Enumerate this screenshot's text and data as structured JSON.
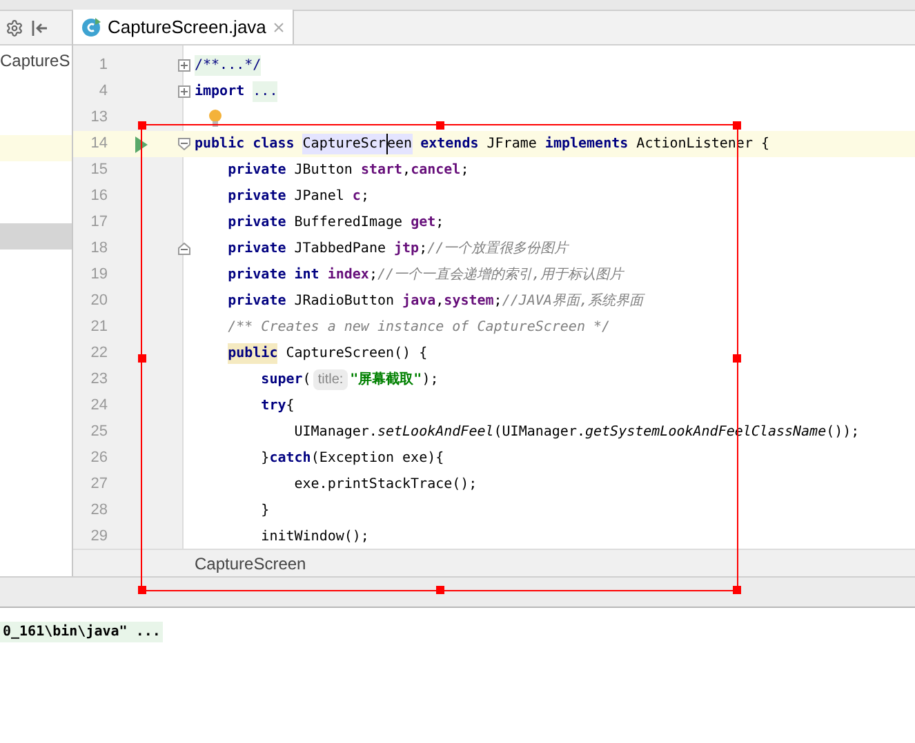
{
  "project_panel": {
    "item": "CaptureS"
  },
  "tab": {
    "label": "CaptureScreen.java",
    "selected": true
  },
  "lines": [
    {
      "number": "1",
      "fold_marker": {
        "kind": "expand"
      },
      "tokens": [
        {
          "text": "/**...*/",
          "kind": "folded"
        }
      ]
    },
    {
      "number": "4",
      "fold_marker": {
        "kind": "expand"
      },
      "tokens": [
        {
          "text": "import ",
          "kind": "keyword"
        },
        {
          "text": "...",
          "kind": "folded"
        }
      ]
    },
    {
      "number": "13",
      "gutter_icon": {
        "kind": "bulb"
      }
    },
    {
      "number": "14",
      "gutter_icon": {
        "kind": "run"
      },
      "fold_marker": {
        "kind": "collapse"
      },
      "current": true,
      "tokens": [
        {
          "text": "public class ",
          "kind": "keyword"
        },
        {
          "text": "CaptureScr",
          "kind": "usage",
          "caret": true
        },
        {
          "text": "een",
          "kind": "usage"
        },
        {
          "text": " extends ",
          "kind": "keyword"
        },
        {
          "text": "JFrame ",
          "kind": "plain"
        },
        {
          "text": "implements",
          "kind": "keyword"
        },
        {
          "text": " ActionListener {",
          "kind": "plain"
        }
      ]
    },
    {
      "number": "15",
      "tokens": [
        {
          "text": "    private ",
          "kind": "keyword"
        },
        {
          "text": "JButton ",
          "kind": "plain"
        },
        {
          "text": "start",
          "kind": "field"
        },
        {
          "text": ",",
          "kind": "plain"
        },
        {
          "text": "cancel",
          "kind": "field"
        },
        {
          "text": ";",
          "kind": "plain"
        }
      ]
    },
    {
      "number": "16",
      "tokens": [
        {
          "text": "    private ",
          "kind": "keyword"
        },
        {
          "text": "JPanel ",
          "kind": "plain"
        },
        {
          "text": "c",
          "kind": "field"
        },
        {
          "text": ";",
          "kind": "plain"
        }
      ]
    },
    {
      "number": "17",
      "tokens": [
        {
          "text": "    private ",
          "kind": "keyword"
        },
        {
          "text": "BufferedImage ",
          "kind": "plain"
        },
        {
          "text": "get",
          "kind": "field"
        },
        {
          "text": ";",
          "kind": "plain"
        }
      ]
    },
    {
      "number": "18",
      "fold_marker": {
        "kind": "end"
      },
      "tokens": [
        {
          "text": "    private ",
          "kind": "keyword"
        },
        {
          "text": "JTabbedPane ",
          "kind": "plain"
        },
        {
          "text": "jtp",
          "kind": "field"
        },
        {
          "text": ";",
          "kind": "plain"
        },
        {
          "text": "//一个放置很多份图片",
          "kind": "comment"
        }
      ]
    },
    {
      "number": "19",
      "tokens": [
        {
          "text": "    private int ",
          "kind": "keyword"
        },
        {
          "text": "index",
          "kind": "field"
        },
        {
          "text": ";",
          "kind": "plain"
        },
        {
          "text": "//一个一直会递增的索引,用于标认图片",
          "kind": "comment"
        }
      ]
    },
    {
      "number": "20",
      "tokens": [
        {
          "text": "    private ",
          "kind": "keyword"
        },
        {
          "text": "JRadioButton ",
          "kind": "plain"
        },
        {
          "text": "java",
          "kind": "field"
        },
        {
          "text": ",",
          "kind": "plain"
        },
        {
          "text": "system",
          "kind": "field"
        },
        {
          "text": ";",
          "kind": "plain"
        },
        {
          "text": "//JAVA界面,系统界面",
          "kind": "comment"
        }
      ]
    },
    {
      "number": "21",
      "tokens": [
        {
          "text": "    /** Creates a new instance of CaptureScreen */",
          "kind": "comment"
        }
      ]
    },
    {
      "number": "22",
      "tokens": [
        {
          "text": "    public",
          "kind": "keyword_match"
        },
        {
          "text": " CaptureScreen() {",
          "kind": "plain"
        }
      ]
    },
    {
      "number": "23",
      "tokens": [
        {
          "text": "        super",
          "kind": "keyword"
        },
        {
          "text": "(",
          "kind": "plain"
        },
        {
          "text": "title:",
          "kind": "hint"
        },
        {
          "text": "\"屏幕截取\"",
          "kind": "string"
        },
        {
          "text": ");",
          "kind": "plain"
        }
      ]
    },
    {
      "number": "24",
      "tokens": [
        {
          "text": "        try",
          "kind": "keyword"
        },
        {
          "text": "{",
          "kind": "plain"
        }
      ]
    },
    {
      "number": "25",
      "tokens": [
        {
          "text": "            UIManager.",
          "kind": "plain"
        },
        {
          "text": "setLookAndFeel",
          "kind": "static"
        },
        {
          "text": "(UIManager.",
          "kind": "plain"
        },
        {
          "text": "getSystemLookAndFeelClassName",
          "kind": "static"
        },
        {
          "text": "());",
          "kind": "plain"
        }
      ]
    },
    {
      "number": "26",
      "tokens": [
        {
          "text": "        }",
          "kind": "plain"
        },
        {
          "text": "catch",
          "kind": "keyword"
        },
        {
          "text": "(Exception exe){",
          "kind": "plain"
        }
      ]
    },
    {
      "number": "27",
      "tokens": [
        {
          "text": "            exe.printStackTrace();",
          "kind": "plain"
        }
      ]
    },
    {
      "number": "28",
      "tokens": [
        {
          "text": "        }",
          "kind": "plain"
        }
      ]
    },
    {
      "number": "29",
      "tokens": [
        {
          "text": "        initWindow();",
          "kind": "plain"
        }
      ]
    }
  ],
  "breadcrumb": "CaptureScreen",
  "console": {
    "line": "0_161\\bin\\java\" ..."
  }
}
